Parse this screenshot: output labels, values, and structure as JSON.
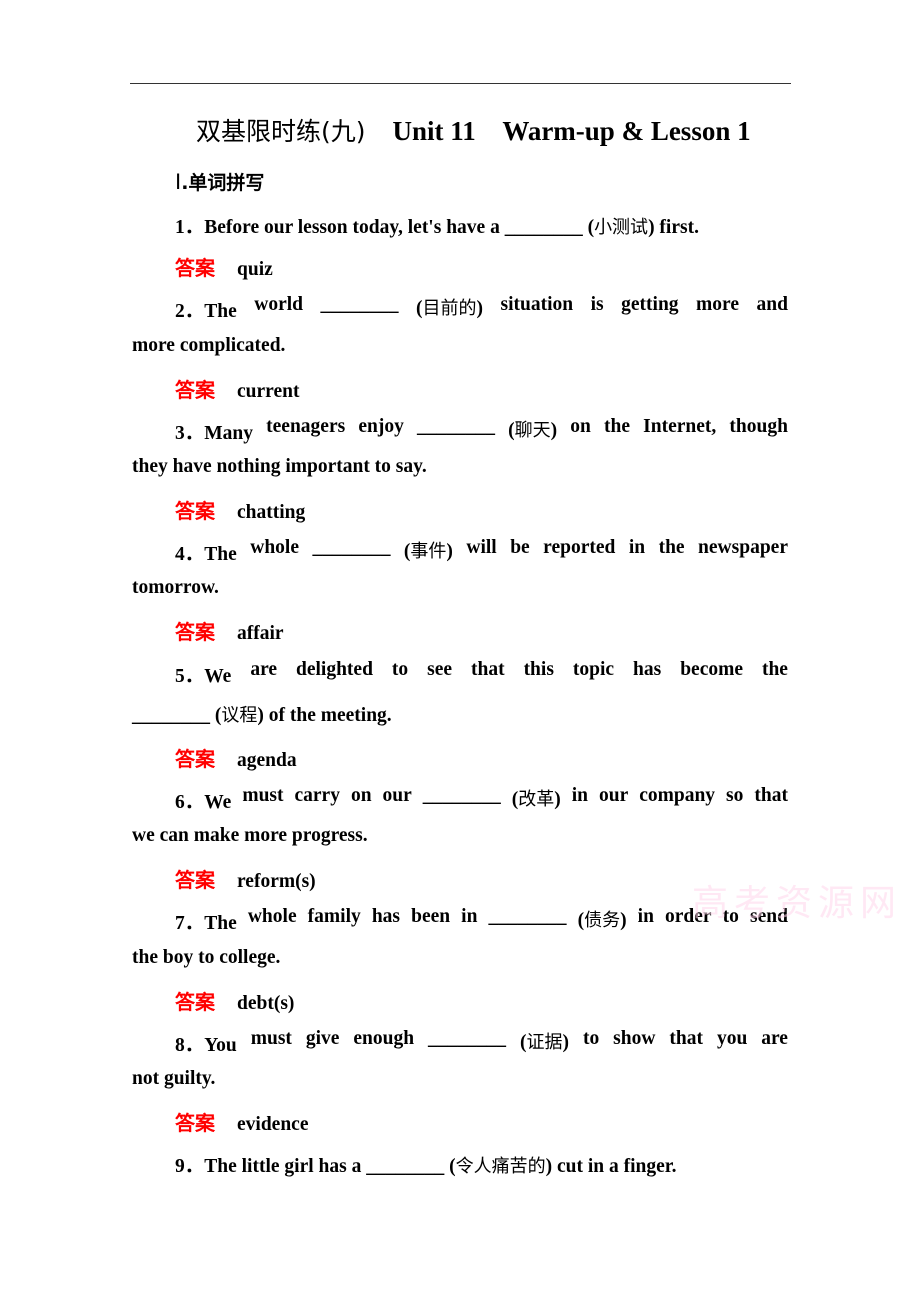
{
  "header": {
    "title_cn": "双基限时练(九)",
    "title_unit": "Unit 11",
    "title_lesson": "Warm-up & Lesson 1"
  },
  "section": {
    "roman": "Ⅰ",
    "label": ".单词拼写"
  },
  "answer_label": "答案",
  "blank": "________",
  "questions": [
    {
      "number": "1．",
      "line1": "Before our lesson today, let's have a ________ (小测试) first.",
      "line2": "",
      "answer": "quiz"
    },
    {
      "number": "2．",
      "line1": "The world ________ (目前的) situation is getting more and",
      "line2": "more complicated.",
      "answer": "current"
    },
    {
      "number": "3．",
      "line1": "Many teenagers enjoy ________ (聊天) on the Internet, though",
      "line2": "they have nothing important to say.",
      "answer": "chatting"
    },
    {
      "number": "4．",
      "line1": "The whole ________ (事件) will be reported in the newspaper",
      "line2": "tomorrow.",
      "answer": "affair"
    },
    {
      "number": "5．",
      "line1": "We are delighted to see that this topic has become the",
      "line2": "________ (议程) of the meeting.",
      "answer": "agenda"
    },
    {
      "number": "6．",
      "line1": "We must carry on our ________ (改革) in our company so that",
      "line2": "we can make more progress.",
      "answer": "reform(s)"
    },
    {
      "number": "7．",
      "line1": "The whole family has been in ________ (债务) in order to send",
      "line2": "the boy to college.",
      "answer": "debt(s)"
    },
    {
      "number": "8．",
      "line1": "You must give enough ________ (证据) to show that you are",
      "line2": "not guilty.",
      "answer": "evidence"
    },
    {
      "number": "9．",
      "line1": "The little girl has a ________ (令人痛苦的) cut in a finger.",
      "line2": "",
      "answer": ""
    }
  ],
  "watermark": "高考资源网"
}
